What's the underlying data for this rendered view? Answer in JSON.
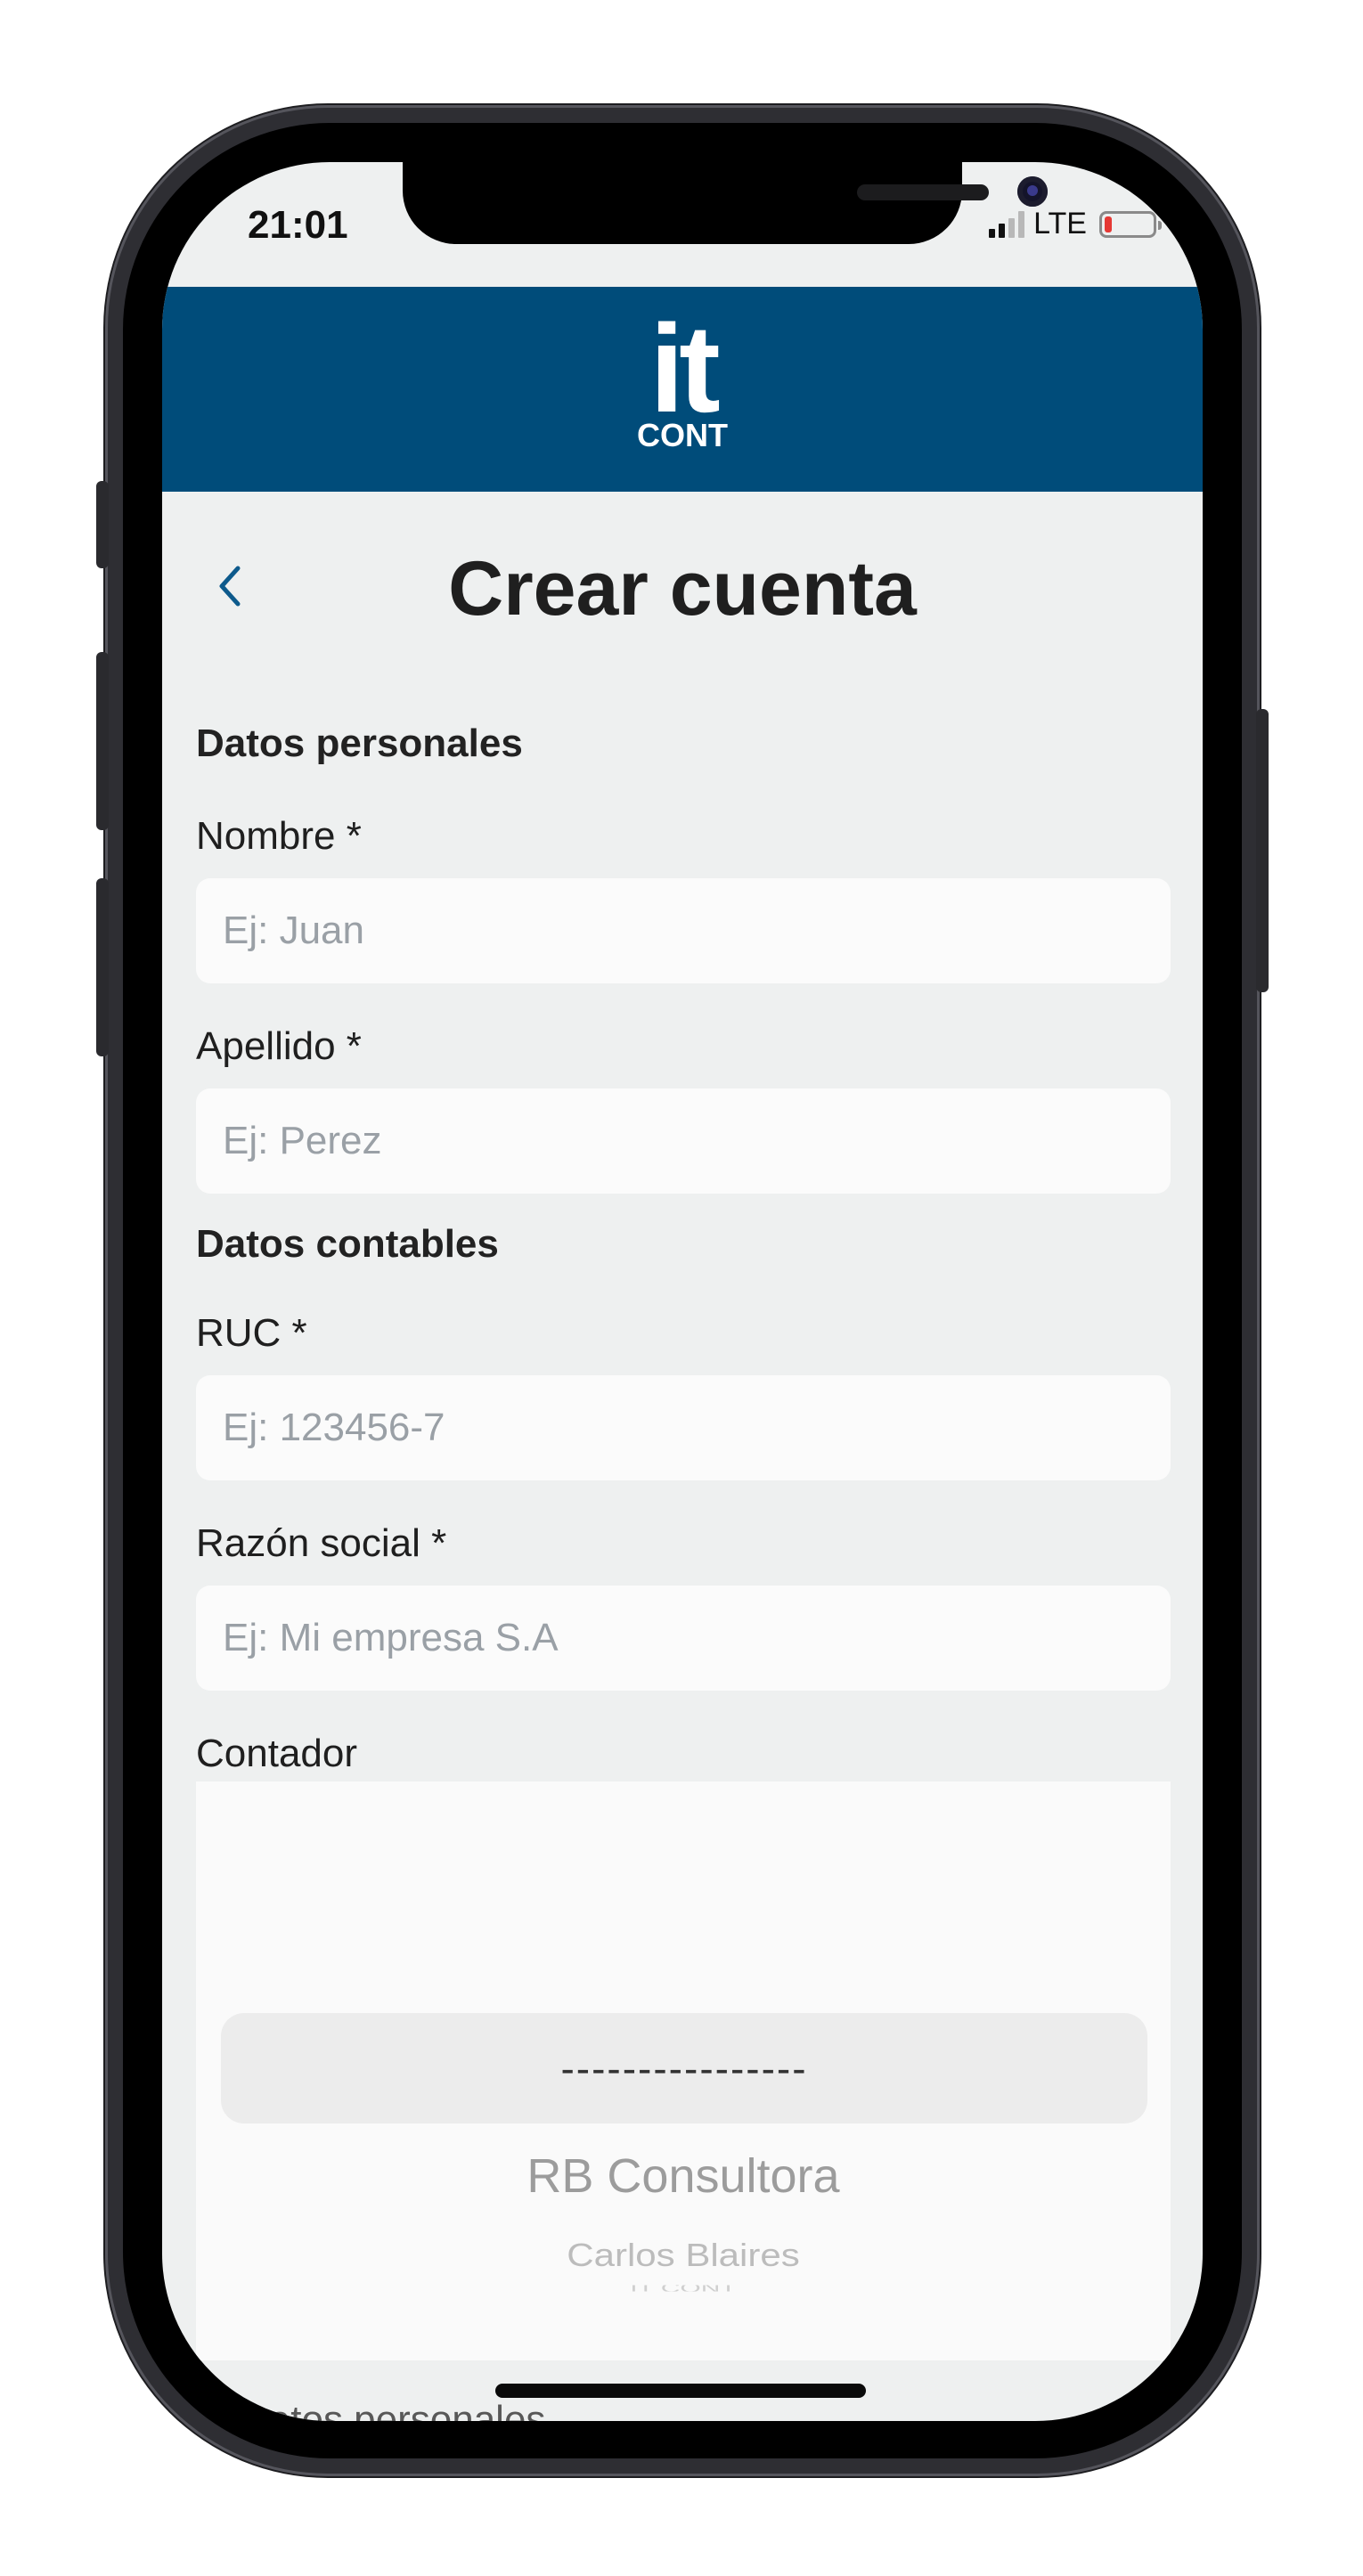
{
  "status_bar": {
    "time": "21:01",
    "network": "LTE",
    "battery_level": 0.15,
    "battery_color": "#e53935"
  },
  "header": {
    "background": "#004c7a",
    "logo_top": "it",
    "logo_bottom": "CONT"
  },
  "page": {
    "title": "Crear cuenta",
    "back_icon": "chevron-left-icon"
  },
  "form": {
    "section_personal": "Datos personales",
    "nombre": {
      "label": "Nombre *",
      "placeholder": "Ej: Juan",
      "value": ""
    },
    "apellido": {
      "label": "Apellido *",
      "placeholder": "Ej: Perez",
      "value": ""
    },
    "section_contable": "Datos contables",
    "ruc": {
      "label": "RUC *",
      "placeholder": "Ej: 123456-7",
      "value": ""
    },
    "razon_social": {
      "label": "Razón social *",
      "placeholder": "Ej: Mi empresa S.A",
      "value": ""
    },
    "contador": {
      "label": "Contador",
      "selected": "----------------",
      "options": [
        "RB Consultora",
        "Carlos Blaires",
        "IT CONT"
      ]
    }
  },
  "peek_text": "Datos personales"
}
